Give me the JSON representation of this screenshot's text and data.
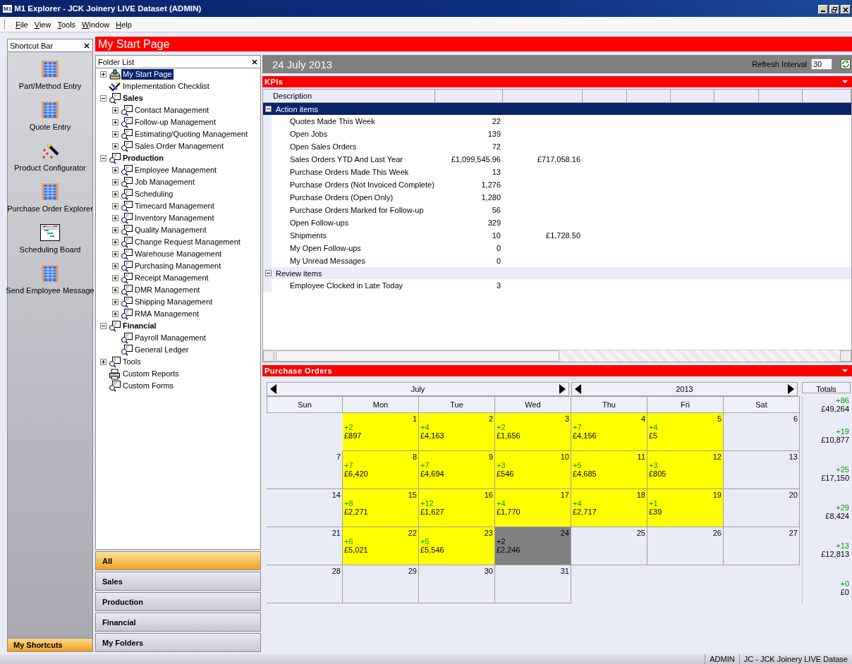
{
  "window": {
    "logo_text": "M1",
    "title": "M1 Explorer - JCK Joinery LIVE Dataset (ADMIN)"
  },
  "menu": [
    "File",
    "View",
    "Tools",
    "Window",
    "Help"
  ],
  "shortcut_bar": {
    "title": "Shortcut Bar",
    "items": [
      {
        "label": "Part/Method Entry",
        "kind": "grid"
      },
      {
        "label": "Quote Entry",
        "kind": "grid"
      },
      {
        "label": "Product Configurator",
        "kind": "wand"
      },
      {
        "label": "Purchase Order Explorer",
        "kind": "grid"
      },
      {
        "label": "Scheduling Board",
        "kind": "board"
      },
      {
        "label": "Send Employee Message",
        "kind": "grid"
      }
    ],
    "footer": {
      "label": "My Shortcuts",
      "selected": true
    }
  },
  "page_title": "My Start Page",
  "folder_list": {
    "title": "Folder List",
    "items": [
      {
        "label": "My Start Page",
        "kind": "start",
        "group": false,
        "expanded": false,
        "selected": true
      },
      {
        "label": "Implementation Checklist",
        "kind": "checklist",
        "group": false,
        "selected": false
      },
      {
        "label": "Sales",
        "kind": "module",
        "group": true,
        "expanded": true,
        "selected": false,
        "children": [
          {
            "label": "Contact Management",
            "kind": "module",
            "group": false,
            "expanded": false,
            "selected": false
          },
          {
            "label": "Follow-up Management",
            "kind": "module",
            "group": false,
            "expanded": false,
            "selected": false
          },
          {
            "label": "Estimating/Quoting Management",
            "kind": "module",
            "group": false,
            "expanded": false,
            "selected": false
          },
          {
            "label": "Sales Order Management",
            "kind": "module",
            "group": false,
            "expanded": false,
            "selected": false
          }
        ]
      },
      {
        "label": "Production",
        "kind": "module",
        "group": true,
        "expanded": true,
        "selected": false,
        "children": [
          {
            "label": "Employee Management",
            "kind": "module",
            "group": false,
            "expanded": false,
            "selected": false
          },
          {
            "label": "Job Management",
            "kind": "module",
            "group": false,
            "expanded": false,
            "selected": false
          },
          {
            "label": "Scheduling",
            "kind": "module",
            "group": false,
            "expanded": false,
            "selected": false
          },
          {
            "label": "Timecard Management",
            "kind": "module",
            "group": false,
            "expanded": false,
            "selected": false
          },
          {
            "label": "Inventory Management",
            "kind": "module",
            "group": false,
            "expanded": false,
            "selected": false
          },
          {
            "label": "Quality Management",
            "kind": "module",
            "group": false,
            "expanded": false,
            "selected": false
          },
          {
            "label": "Change Request Management",
            "kind": "module",
            "group": false,
            "expanded": false,
            "selected": false
          },
          {
            "label": "Warehouse Management",
            "kind": "module",
            "group": false,
            "expanded": false,
            "selected": false
          },
          {
            "label": "Purchasing Management",
            "kind": "module",
            "group": false,
            "expanded": false,
            "selected": false
          },
          {
            "label": "Receipt Management",
            "kind": "module",
            "group": false,
            "expanded": false,
            "selected": false
          },
          {
            "label": "DMR Management",
            "kind": "module",
            "group": false,
            "expanded": false,
            "selected": false
          },
          {
            "label": "Shipping Management",
            "kind": "module",
            "group": false,
            "expanded": false,
            "selected": false
          },
          {
            "label": "RMA Management",
            "kind": "module",
            "group": false,
            "expanded": false,
            "selected": false
          }
        ]
      },
      {
        "label": "Financial",
        "kind": "module",
        "group": true,
        "expanded": true,
        "selected": false,
        "children": [
          {
            "label": "Payroll Management",
            "kind": "module",
            "group": false,
            "selected": false
          },
          {
            "label": "General Ledger",
            "kind": "module",
            "group": false,
            "selected": false
          }
        ]
      },
      {
        "label": "Tools",
        "kind": "module",
        "group": false,
        "expanded": false,
        "selected": false
      },
      {
        "label": "Custom Reports",
        "kind": "reports",
        "group": false,
        "selected": false
      },
      {
        "label": "Custom Forms",
        "kind": "module",
        "group": false,
        "selected": false
      }
    ],
    "nav_buttons": [
      {
        "label": "All",
        "selected": true
      },
      {
        "label": "Sales",
        "selected": false
      },
      {
        "label": "Production",
        "selected": false
      },
      {
        "label": "Financial",
        "selected": false
      },
      {
        "label": "My Folders",
        "selected": false
      }
    ]
  },
  "date_bar": {
    "date": "24 July 2013",
    "refresh_label": "Refresh Interval",
    "refresh_value": "30"
  },
  "kpis": {
    "title": "KPIs",
    "columns": [
      "Description"
    ],
    "groups": [
      {
        "label": "Action items",
        "expanded": true,
        "selected": true,
        "rows": [
          {
            "description": "Quotes Made This Week",
            "values": [
              "22"
            ]
          },
          {
            "description": "Open Jobs",
            "values": [
              "139"
            ]
          },
          {
            "description": "Open Sales Orders",
            "values": [
              "72"
            ]
          },
          {
            "description": "Sales Orders YTD And Last Year",
            "values": [
              "£1,099,545.96",
              "£717,058.16"
            ]
          },
          {
            "description": "Purchase Orders Made This Week",
            "values": [
              "13"
            ]
          },
          {
            "description": "Purchase Orders (Not Invoiced Complete)",
            "values": [
              "1,276"
            ]
          },
          {
            "description": "Purchase Orders (Open Only)",
            "values": [
              "1,280"
            ]
          },
          {
            "description": "Purchase Orders Marked for Follow-up",
            "values": [
              "56"
            ]
          },
          {
            "description": "Open Follow-ups",
            "values": [
              "329"
            ]
          },
          {
            "description": "Shipments",
            "values": [
              "10",
              "£1,728.50"
            ]
          },
          {
            "description": "My Open Follow-ups",
            "values": [
              "0"
            ]
          },
          {
            "description": "My Unread Messages",
            "values": [
              "0"
            ]
          }
        ]
      },
      {
        "label": "Review items",
        "expanded": true,
        "selected": false,
        "rows": [
          {
            "description": "Employee Clocked in Late Today",
            "values": [
              "3"
            ]
          }
        ]
      }
    ]
  },
  "purchase_orders": {
    "title": "Purchase Orders",
    "month": "July",
    "year": "2013",
    "totals_label": "Totals",
    "weekdays": [
      "Sun",
      "Mon",
      "Tue",
      "Wed",
      "Thu",
      "Fri",
      "Sat"
    ],
    "month_total": {
      "count": "+86",
      "amount": "£49,264"
    },
    "weeks": [
      {
        "days": [
          {
            "kind": "blank"
          },
          {
            "kind": "orders",
            "day": "1",
            "count": "+2",
            "amount": "£897"
          },
          {
            "kind": "orders",
            "day": "2",
            "count": "+4",
            "amount": "£4,163"
          },
          {
            "kind": "orders",
            "day": "3",
            "count": "+2",
            "amount": "£1,656"
          },
          {
            "kind": "orders",
            "day": "4",
            "count": "+7",
            "amount": "£4,156"
          },
          {
            "kind": "orders",
            "day": "5",
            "count": "+4",
            "amount": "£5"
          },
          {
            "kind": "empty",
            "day": "6"
          }
        ],
        "total": {
          "count": "+19",
          "amount": "£10,877"
        }
      },
      {
        "days": [
          {
            "kind": "empty",
            "day": "7"
          },
          {
            "kind": "orders",
            "day": "8",
            "count": "+7",
            "amount": "£6,420"
          },
          {
            "kind": "orders",
            "day": "9",
            "count": "+7",
            "amount": "£4,694"
          },
          {
            "kind": "orders",
            "day": "10",
            "count": "+3",
            "amount": "£546"
          },
          {
            "kind": "orders",
            "day": "11",
            "count": "+5",
            "amount": "£4,685"
          },
          {
            "kind": "orders",
            "day": "12",
            "count": "+3",
            "amount": "£805"
          },
          {
            "kind": "empty",
            "day": "13"
          }
        ],
        "total": {
          "count": "+25",
          "amount": "£17,150"
        }
      },
      {
        "days": [
          {
            "kind": "empty",
            "day": "14"
          },
          {
            "kind": "orders",
            "day": "15",
            "count": "+8",
            "amount": "£2,271"
          },
          {
            "kind": "orders",
            "day": "16",
            "count": "+12",
            "amount": "£1,627"
          },
          {
            "kind": "orders",
            "day": "17",
            "count": "+4",
            "amount": "£1,770"
          },
          {
            "kind": "orders",
            "day": "18",
            "count": "+4",
            "amount": "£2,717"
          },
          {
            "kind": "orders",
            "day": "19",
            "count": "+1",
            "amount": "£39"
          },
          {
            "kind": "empty",
            "day": "20"
          }
        ],
        "total": {
          "count": "+29",
          "amount": "£8,424"
        }
      },
      {
        "days": [
          {
            "kind": "empty",
            "day": "21"
          },
          {
            "kind": "orders",
            "day": "22",
            "count": "+6",
            "amount": "£5,021"
          },
          {
            "kind": "orders",
            "day": "23",
            "count": "+5",
            "amount": "£5,546"
          },
          {
            "kind": "today",
            "day": "24",
            "count": "+2",
            "amount": "£2,246"
          },
          {
            "kind": "empty",
            "day": "25"
          },
          {
            "kind": "empty",
            "day": "26"
          },
          {
            "kind": "empty",
            "day": "27"
          }
        ],
        "total": {
          "count": "+13",
          "amount": "£12,813"
        }
      },
      {
        "days": [
          {
            "kind": "empty",
            "day": "28"
          },
          {
            "kind": "empty",
            "day": "29"
          },
          {
            "kind": "empty",
            "day": "30"
          },
          {
            "kind": "empty",
            "day": "31"
          },
          {
            "kind": "blank"
          },
          {
            "kind": "blank"
          },
          {
            "kind": "blank"
          }
        ],
        "total": {
          "count": "+0",
          "amount": "£0"
        }
      }
    ]
  },
  "status_bar": [
    "ADMIN",
    "JC - JCK Joinery LIVE Datase"
  ]
}
